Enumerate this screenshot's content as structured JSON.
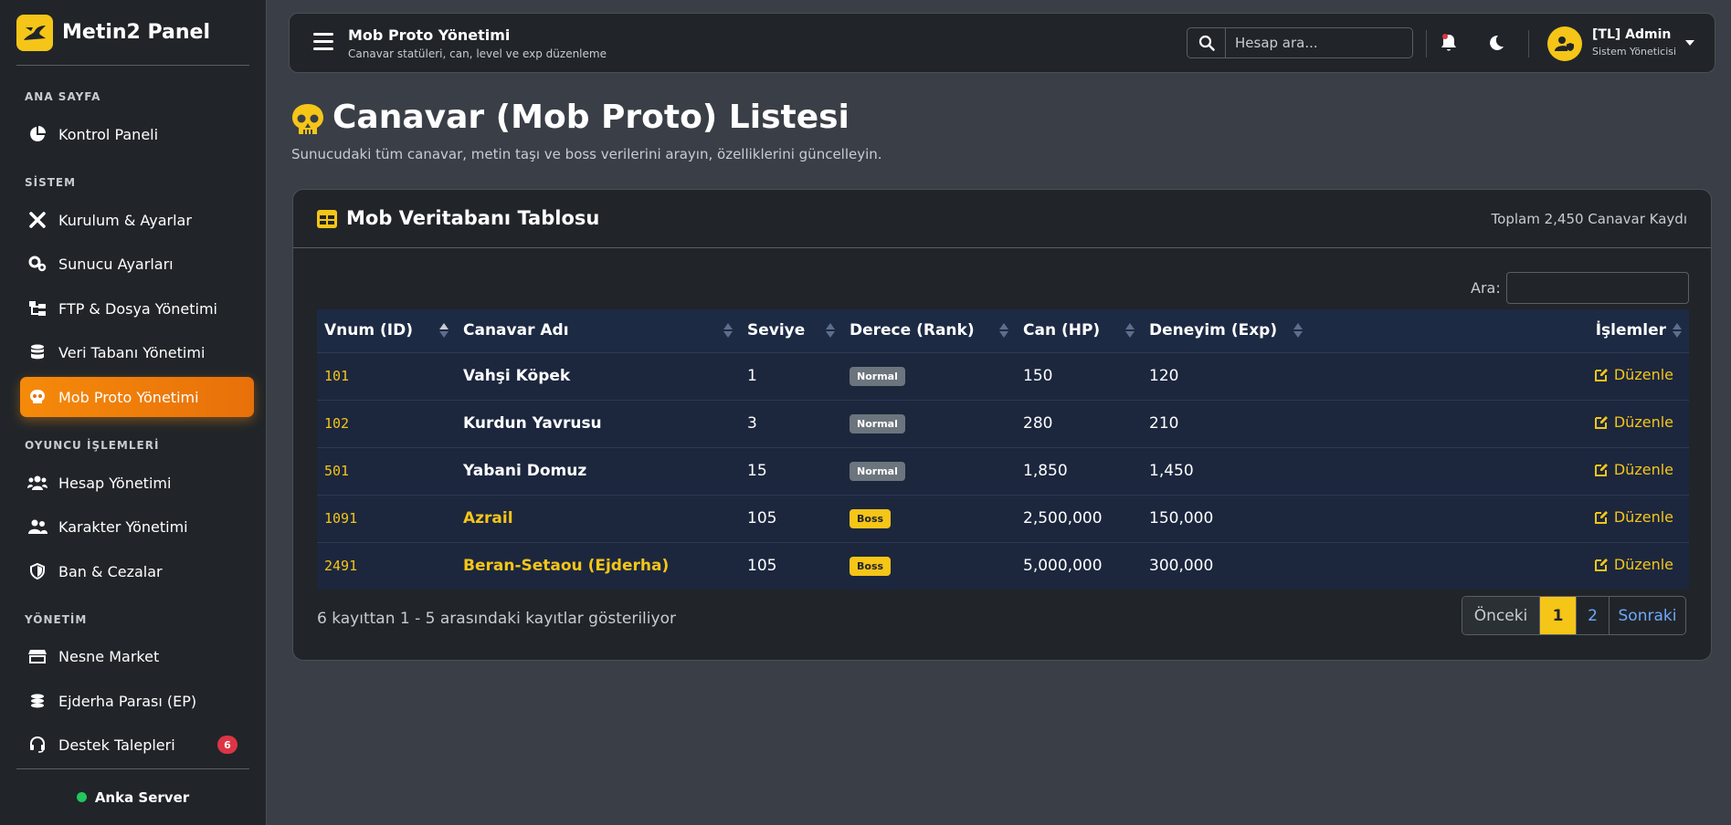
{
  "brand": {
    "title": "Metin2 Panel"
  },
  "sidebar": {
    "sections": [
      {
        "label": "ANA SAYFA"
      },
      {
        "label": "SİSTEM"
      },
      {
        "label": "OYUNCU İŞLEMLERİ"
      },
      {
        "label": "YÖNETİM"
      }
    ],
    "items": [
      {
        "label": "Kontrol Paneli",
        "icon": "pie-chart-icon"
      },
      {
        "label": "Kurulum & Ayarlar",
        "icon": "tools-icon"
      },
      {
        "label": "Sunucu Ayarları",
        "icon": "gears-icon"
      },
      {
        "label": "FTP & Dosya Yönetimi",
        "icon": "folder-tree-icon"
      },
      {
        "label": "Veri Tabanı Yönetimi",
        "icon": "database-icon"
      },
      {
        "label": "Mob Proto Yönetimi",
        "icon": "skull-icon",
        "active": true
      },
      {
        "label": "Hesap Yönetimi",
        "icon": "users-icon"
      },
      {
        "label": "Karakter Yönetimi",
        "icon": "user-group-icon"
      },
      {
        "label": "Ban & Cezalar",
        "icon": "shield-icon"
      },
      {
        "label": "Nesne Market",
        "icon": "store-icon"
      },
      {
        "label": "Ejderha Parası (EP)",
        "icon": "coins-icon"
      },
      {
        "label": "Destek Talepleri",
        "icon": "headset-icon",
        "badge": "6"
      }
    ],
    "footer": {
      "server": "Anka Server",
      "status_color": "#22c55e"
    }
  },
  "topbar": {
    "title": "Mob Proto Yönetimi",
    "subtitle": "Canavar statüleri, can, level ve exp düzenleme",
    "search_placeholder": "Hesap ara...",
    "user_name": "[TL] Admin",
    "user_role": "Sistem Yöneticisi"
  },
  "page": {
    "title": "Canavar (Mob Proto) Listesi",
    "subtitle": "Sunucudaki tüm canavar, metin taşı ve boss verilerini arayın, özelliklerini güncelleyin."
  },
  "card": {
    "title": "Mob Veritabanı Tablosu",
    "count_text": "Toplam 2,450 Canavar Kaydı",
    "filter_label": "Ara:"
  },
  "table": {
    "headers": [
      "Vnum (ID)",
      "Canavar Adı",
      "Seviye",
      "Derece (Rank)",
      "Can (HP)",
      "Deneyim (Exp)",
      "İşlemler"
    ],
    "rows": [
      {
        "vnum": "101",
        "name": "Vahşi Köpek",
        "level": "1",
        "rank": "Normal",
        "hp": "150",
        "exp": "120",
        "action": "Düzenle"
      },
      {
        "vnum": "102",
        "name": "Kurdun Yavrusu",
        "level": "3",
        "rank": "Normal",
        "hp": "280",
        "exp": "210",
        "action": "Düzenle"
      },
      {
        "vnum": "501",
        "name": "Yabani Domuz",
        "level": "15",
        "rank": "Normal",
        "hp": "1,850",
        "exp": "1,450",
        "action": "Düzenle"
      },
      {
        "vnum": "1091",
        "name": "Azrail",
        "level": "105",
        "rank": "Boss",
        "hp": "2,500,000",
        "exp": "150,000",
        "action": "Düzenle"
      },
      {
        "vnum": "2491",
        "name": "Beran-Setaou (Ejderha)",
        "level": "105",
        "rank": "Boss",
        "hp": "5,000,000",
        "exp": "300,000",
        "action": "Düzenle"
      }
    ],
    "info": "6 kayıttan 1 - 5 arasındaki kayıtlar gösteriliyor"
  },
  "pagination": {
    "prev": "Önceki",
    "pages": [
      "1",
      "2"
    ],
    "current": "1",
    "next": "Sonraki"
  },
  "colors": {
    "accent": "#f5c518",
    "active_nav": "#f58a0a",
    "badge": "#dc3545",
    "link": "#6ea8fe"
  }
}
